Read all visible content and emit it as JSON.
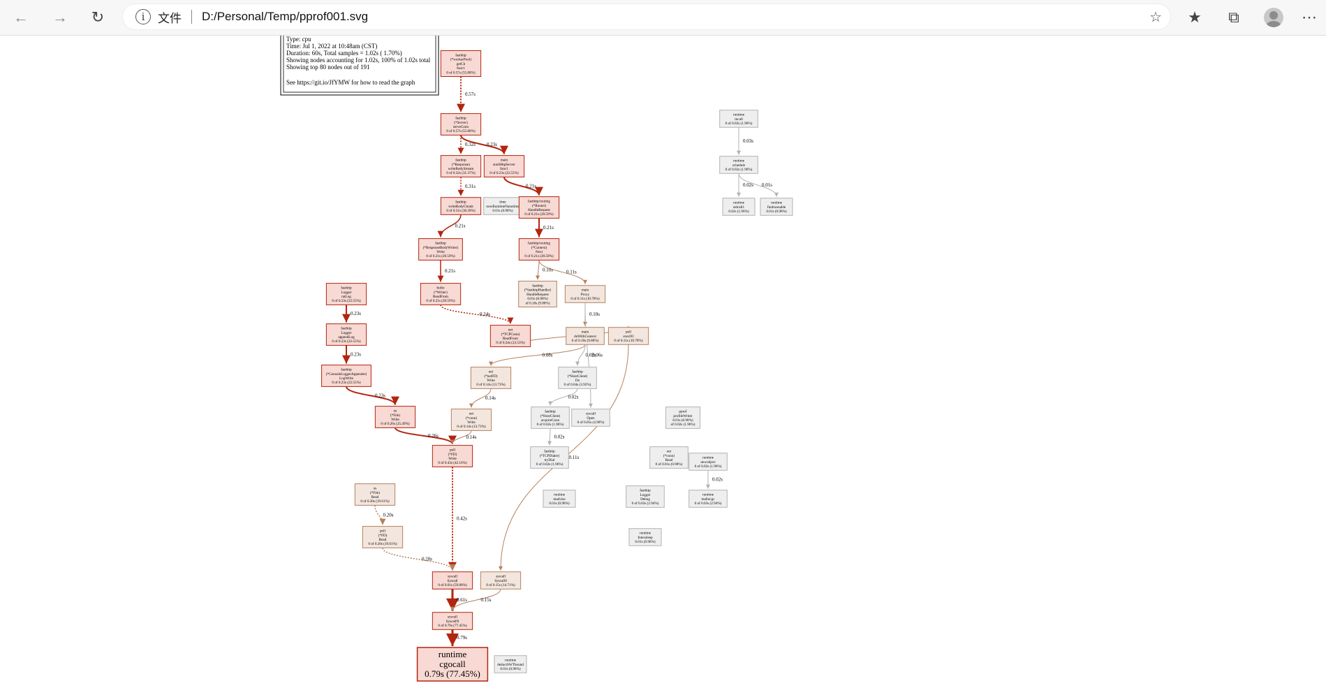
{
  "browser": {
    "address_label": "文件",
    "url": "D:/Personal/Temp/pprof001.svg"
  },
  "legend": {
    "lines": [
      "Type: cpu",
      "Time: Jul 1, 2022 at 10:48am (CST)",
      "Duration: 60s, Total samples = 1.02s ( 1.70%)",
      "Showing nodes accounting for 1.02s, 100% of 1.02s total",
      "Showing top 80 nodes out of 191",
      "",
      "See https://git.io/JfYMW for how to read the graph"
    ]
  },
  "colors": {
    "hot_fill": "#f8d9d3",
    "hot_stroke": "#b2250e",
    "warm_fill": "#f3e6de",
    "warm_stroke": "#b5805d",
    "cold_fill": "#eeeeee",
    "cold_stroke": "#b2b2b2"
  },
  "nodes": [
    {
      "id": "n1",
      "lines": [
        "fasthttp",
        "(*workerPool)",
        "getCh",
        "func1",
        "0 of 0.57s (55.88%)"
      ],
      "heat": "hot"
    },
    {
      "id": "n2",
      "lines": [
        "fasthttp",
        "(*Server)",
        "serveConn",
        "0 of 0.57s (55.88%)"
      ],
      "heat": "hot"
    },
    {
      "id": "n3",
      "lines": [
        "fasthttp",
        "(*Response)",
        "writeBodyStream",
        "0 of 0.32s (31.37%)"
      ],
      "heat": "hot"
    },
    {
      "id": "n4",
      "lines": [
        "main",
        "startHttpServer",
        "func1",
        "0 of 0.23s (22.55%)"
      ],
      "heat": "hot"
    },
    {
      "id": "n5",
      "lines": [
        "fasthttp",
        "writeBodyChunk",
        "0 of 0.31s (30.39%)"
      ],
      "heat": "hot"
    },
    {
      "id": "n6",
      "lines": [
        "time",
        "nowRuntimeNanotime",
        "0.01s (0.98%)"
      ],
      "heat": "cold"
    },
    {
      "id": "n7",
      "lines": [
        "fasthttp/routing",
        "(*Router)",
        "HandleRequest",
        "0 of 0.21s (20.59%)"
      ],
      "heat": "hot"
    },
    {
      "id": "n8",
      "lines": [
        "fasthttp",
        "(*ResponseBodyWriter)",
        "Write",
        "0 of 0.21s (20.59%)"
      ],
      "heat": "hot"
    },
    {
      "id": "n9",
      "lines": [
        "fasthttp/routing",
        "(*Context)",
        "Next",
        "0 of 0.21s (20.59%)"
      ],
      "heat": "hot"
    },
    {
      "id": "n10",
      "lines": [
        "fasthttp",
        "(*fasthttpHandler)",
        "HandleRequest",
        "0.01s (0.98%)",
        "of 0.10s (9.80%)"
      ],
      "heat": "warm"
    },
    {
      "id": "n11",
      "lines": [
        "main",
        "Proxy",
        "0 of 0.11s (10.78%)"
      ],
      "heat": "warm"
    },
    {
      "id": "n12",
      "lines": [
        "bufio",
        "(*Writer)",
        "ReadFrom",
        "0 of 0.21s (20.59%)"
      ],
      "heat": "hot"
    },
    {
      "id": "n13",
      "lines": [
        "fasthttp",
        "Logger",
        "ratLog",
        "0 of 0.23s (22.55%)"
      ],
      "heat": "hot"
    },
    {
      "id": "n14",
      "lines": [
        "fasthttp",
        "Logger",
        "appendLog",
        "0 of 0.23s (22.55%)"
      ],
      "heat": "hot"
    },
    {
      "id": "n15",
      "lines": [
        "fasthttp",
        "(*ConsoleLoggerAppender)",
        "LogWrite",
        "0 of 0.23s (22.55%)"
      ],
      "heat": "hot"
    },
    {
      "id": "n16",
      "lines": [
        "net",
        "(*TCPConn)",
        "ReadFrom",
        "0 of 0.24s (23.53%)"
      ],
      "heat": "hot"
    },
    {
      "id": "n17",
      "lines": [
        "os",
        "(*File)",
        "Write",
        "0 of 0.26s (25.49%)"
      ],
      "heat": "hot"
    },
    {
      "id": "n18",
      "lines": [
        "poll",
        "(*FD)",
        "Write",
        "0 of 0.43s (42.16%)"
      ],
      "heat": "hot"
    },
    {
      "id": "n19",
      "lines": [
        "os",
        "(*File)",
        "Read",
        "0 of 0.20s (19.61%)"
      ],
      "heat": "warm"
    },
    {
      "id": "n20",
      "lines": [
        "poll",
        "(*FD)",
        "Read",
        "0 of 0.20s (19.61%)"
      ],
      "heat": "warm"
    },
    {
      "id": "n21",
      "lines": [
        "syscall",
        "Syscall",
        "0 of 0.61s (59.80%)"
      ],
      "heat": "hot"
    },
    {
      "id": "n22",
      "lines": [
        "syscall",
        "SyscallN",
        "0 of 0.79s (77.45%)"
      ],
      "heat": "hot"
    },
    {
      "id": "n23",
      "lines": [
        "runtime",
        "cgocall",
        "0.79s (77.45%)"
      ],
      "heat": "hot",
      "big": true
    },
    {
      "id": "n24",
      "lines": [
        "runtime",
        "deductSWTbound",
        "0.01s (0.98%)"
      ],
      "heat": "cold"
    },
    {
      "id": "n25",
      "lines": [
        "syscall",
        "Syscall9",
        "0 of 0.15s (14.71%)"
      ],
      "heat": "warm"
    },
    {
      "id": "n26",
      "lines": [
        "net",
        "(*netFD)",
        "Write",
        "0 of 0.14s (13.73%)"
      ],
      "heat": "warm"
    },
    {
      "id": "n27",
      "lines": [
        "net",
        "(*conn)",
        "Write",
        "0 of 0.14s (13.73%)"
      ],
      "heat": "warm"
    },
    {
      "id": "n28",
      "lines": [
        "poll",
        "execIO",
        "0 of 0.11s (10.78%)"
      ],
      "heat": "warm"
    },
    {
      "id": "n29",
      "lines": [
        "main",
        "doWithContext",
        "0 of 0.10s (9.80%)"
      ],
      "heat": "warm"
    },
    {
      "id": "n30",
      "lines": [
        "fasthttp",
        "(*HostClient)",
        "Do",
        "0 of 0.04s (3.92%)"
      ],
      "heat": "cold"
    },
    {
      "id": "n31",
      "lines": [
        "runtime",
        "mallocgc",
        "0 of 0.03s (2.94%)"
      ],
      "heat": "cold"
    },
    {
      "id": "n32",
      "lines": [
        "runtime",
        "newobject",
        "0 of 0.02s (1.96%)"
      ],
      "heat": "cold"
    },
    {
      "id": "n33",
      "lines": [
        "pprof",
        "profileWriter",
        "0.01s (0.98%)",
        "of 0.02s (1.96%)"
      ],
      "heat": "cold"
    },
    {
      "id": "n34",
      "lines": [
        "net",
        "(*conn)",
        "Read",
        "0 of 0.01s (0.98%)"
      ],
      "heat": "cold"
    },
    {
      "id": "n35",
      "lines": [
        "runtime",
        "futexsleep",
        "0.01s (0.98%)"
      ],
      "heat": "cold"
    },
    {
      "id": "n36",
      "lines": [
        "fasthttp",
        "Logger",
        "Debug",
        "0 of 0.03s (2.94%)"
      ],
      "heat": "cold"
    },
    {
      "id": "n37",
      "lines": [
        "fasthttp",
        "(*HostClient)",
        "acquireConn",
        "0 of 0.02s (1.96%)"
      ],
      "heat": "cold"
    },
    {
      "id": "n38",
      "lines": [
        "syscall",
        "Open",
        "0 of 0.05s (4.90%)"
      ],
      "heat": "cold"
    },
    {
      "id": "n39",
      "lines": [
        "fasthttp",
        "(*TCPDialer)",
        "tryDial",
        "0 of 0.02s (1.96%)"
      ],
      "heat": "cold"
    },
    {
      "id": "n40",
      "lines": [
        "runtime",
        "madvise",
        "0.01s (0.98%)"
      ],
      "heat": "cold"
    },
    {
      "id": "n41",
      "lines": [
        "runtime",
        "mcall",
        "0 of 0.02s (1.96%)"
      ],
      "heat": "cold"
    },
    {
      "id": "n42",
      "lines": [
        "runtime",
        "schedule",
        "0 of 0.02s (1.96%)"
      ],
      "heat": "cold"
    },
    {
      "id": "n43",
      "lines": [
        "runtime",
        "stdcall1",
        "0.02s (1.96%)"
      ],
      "heat": "cold"
    },
    {
      "id": "n44",
      "lines": [
        "runtime",
        "findrunnable",
        "0.01s (0.98%)"
      ],
      "heat": "cold"
    }
  ],
  "edges": [
    {
      "from": "n1",
      "to": "n2",
      "label": "0.57s",
      "w": 2,
      "heat": "hot",
      "dash": true
    },
    {
      "from": "n2",
      "to": "n3",
      "label": "0.32s",
      "w": 1.5,
      "heat": "hot",
      "dash": true
    },
    {
      "from": "n2",
      "to": "n4",
      "label": "0.23s",
      "w": 2,
      "heat": "hot"
    },
    {
      "from": "n3",
      "to": "n5",
      "label": "0.31s",
      "w": 1.5,
      "heat": "hot",
      "dash": true
    },
    {
      "from": "n4",
      "to": "n7",
      "label": "0.21s",
      "w": 2,
      "heat": "hot"
    },
    {
      "from": "n5",
      "to": "n8",
      "label": "0.21s",
      "w": 1.5,
      "heat": "hot"
    },
    {
      "from": "n7",
      "to": "n9",
      "label": "0.21s",
      "w": 2,
      "heat": "hot"
    },
    {
      "from": "n9",
      "to": "n10",
      "label": "0.10s",
      "w": 1,
      "heat": "warm"
    },
    {
      "from": "n9",
      "to": "n11",
      "label": "0.11s",
      "w": 1,
      "heat": "warm"
    },
    {
      "from": "n8",
      "to": "n12",
      "label": "0.21s",
      "w": 1.5,
      "heat": "hot"
    },
    {
      "from": "n12",
      "to": "n16",
      "label": "0.24s",
      "w": 1.5,
      "heat": "hot",
      "dash": true
    },
    {
      "from": "n13",
      "to": "n14",
      "label": "0.23s",
      "w": 2,
      "heat": "hot"
    },
    {
      "from": "n14",
      "to": "n15",
      "label": "0.23s",
      "w": 2,
      "heat": "hot"
    },
    {
      "from": "n15",
      "to": "n17",
      "label": "0.23s",
      "w": 2,
      "heat": "hot"
    },
    {
      "from": "n17",
      "to": "n18",
      "label": "0.26s",
      "w": 2,
      "heat": "hot"
    },
    {
      "from": "n18",
      "to": "n21",
      "label": "0.42s",
      "w": 2,
      "heat": "hot",
      "dash": true
    },
    {
      "from": "n19",
      "to": "n20",
      "label": "0.20s",
      "w": 1.5,
      "heat": "warm",
      "dash": true
    },
    {
      "from": "n20",
      "to": "n21",
      "label": "0.20s",
      "w": 1.5,
      "heat": "warm",
      "dash": true
    },
    {
      "from": "n21",
      "to": "n22",
      "label": "0.61s",
      "w": 3,
      "heat": "hot"
    },
    {
      "from": "n25",
      "to": "n22",
      "label": "0.15s",
      "w": 1,
      "heat": "warm"
    },
    {
      "from": "n22",
      "to": "n23",
      "label": "0.79s",
      "w": 3,
      "heat": "hot"
    },
    {
      "from": "n11",
      "to": "n29",
      "label": "0.10s",
      "w": 1,
      "heat": "warm"
    },
    {
      "from": "n29",
      "to": "n26",
      "label": "0.08s",
      "w": 1,
      "heat": "warm"
    },
    {
      "from": "n26",
      "to": "n27",
      "label": "0.14s",
      "w": 1,
      "heat": "warm"
    },
    {
      "from": "n27",
      "to": "n18",
      "label": "0.14s",
      "w": 1,
      "heat": "warm"
    },
    {
      "from": "n28",
      "to": "n25",
      "label": "0.11s",
      "w": 1,
      "heat": "warm"
    },
    {
      "from": "n29",
      "to": "n30",
      "label": "0.02s",
      "w": 1,
      "heat": "cold"
    },
    {
      "from": "n30",
      "to": "n37",
      "label": "0.02s",
      "w": 1,
      "heat": "cold"
    },
    {
      "from": "n37",
      "to": "n39",
      "label": "0.02s",
      "w": 1,
      "heat": "cold"
    },
    {
      "from": "n11",
      "to": "n38",
      "label": "0.06s",
      "w": 1,
      "heat": "cold"
    },
    {
      "from": "n41",
      "to": "n42",
      "label": "0.03s",
      "w": 1,
      "heat": "cold"
    },
    {
      "from": "n42",
      "to": "n43",
      "label": "0.02s",
      "w": 1,
      "heat": "cold"
    },
    {
      "from": "n42",
      "to": "n44",
      "label": "0.01s",
      "w": 1,
      "heat": "cold"
    },
    {
      "from": "n32",
      "to": "n31",
      "label": "0.02s",
      "w": 1,
      "heat": "cold"
    },
    {
      "from": "n16",
      "to": "n28",
      "label": "0.11s",
      "w": 1,
      "heat": "warm"
    }
  ]
}
